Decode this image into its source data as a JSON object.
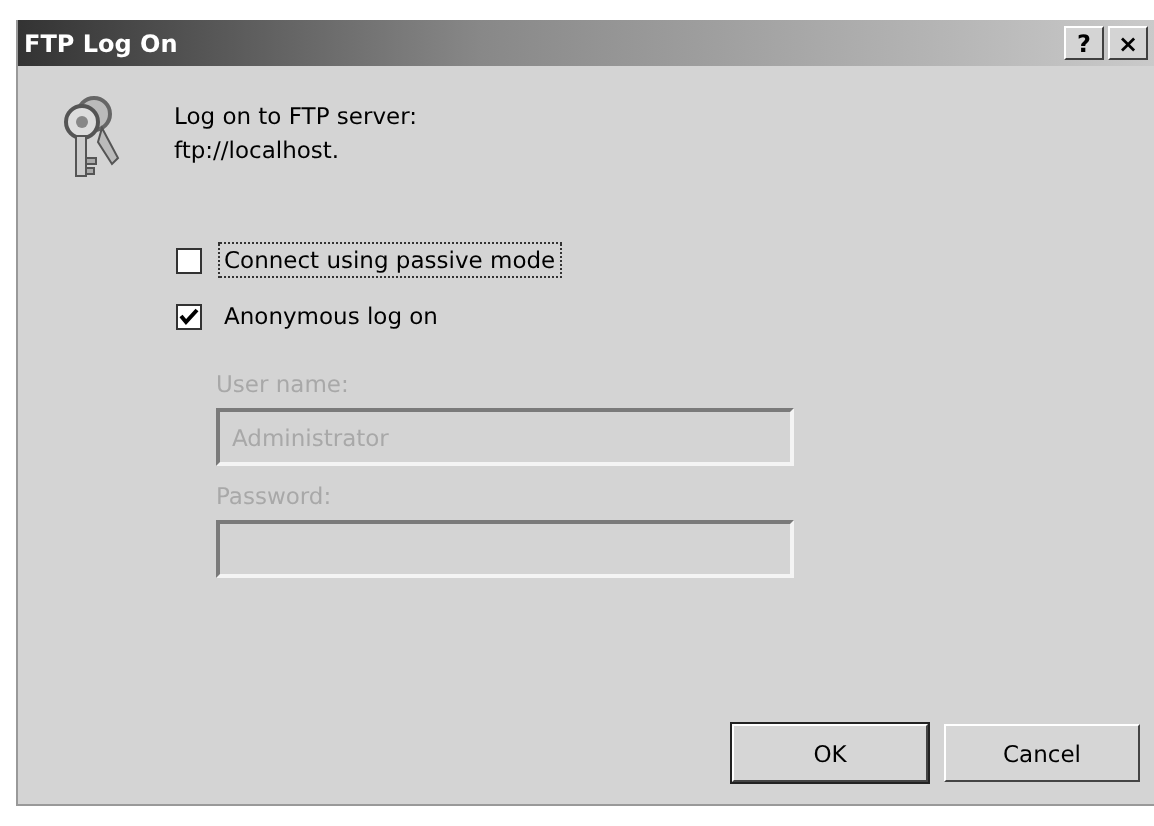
{
  "window": {
    "title": "FTP Log On",
    "help_button": "?",
    "close_button": "×"
  },
  "message": {
    "line_1": "Log on to FTP server:",
    "line_2": "ftp://localhost."
  },
  "options": [
    {
      "label": "Connect using passive mode",
      "checked": false,
      "focused": true
    },
    {
      "label": "Anonymous log on",
      "checked": true,
      "focused": false
    }
  ],
  "fields": [
    {
      "label": "User name:",
      "value": "Administrator",
      "disabled": true
    },
    {
      "label": "Password:",
      "disabled": true
    }
  ],
  "buttons": [
    {
      "label": "OK",
      "default": true
    },
    {
      "label": "Cancel",
      "default": false
    }
  ]
}
